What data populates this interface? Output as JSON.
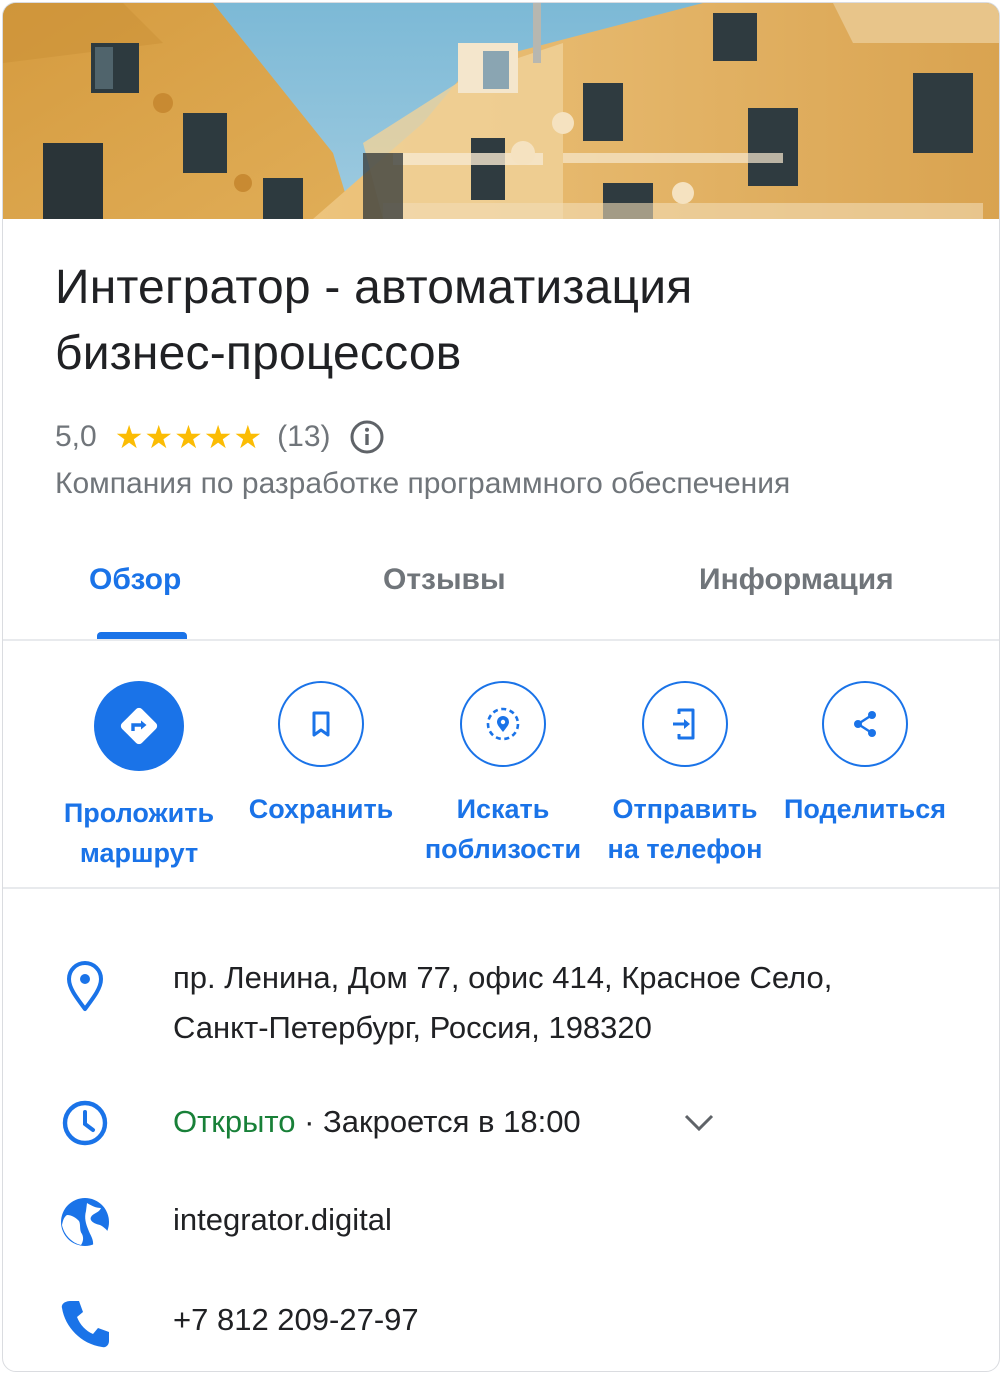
{
  "place": {
    "title_line1": "Интегратор - автоматизация",
    "title_line2": "бизнес-процессов",
    "rating": "5,0",
    "stars": "★★★★★",
    "review_count": "(13)",
    "category": "Компания по разработке программного обеспечения"
  },
  "tabs": [
    {
      "label": "Обзор",
      "active": true
    },
    {
      "label": "Отзывы",
      "active": false
    },
    {
      "label": "Информация",
      "active": false
    }
  ],
  "actions": [
    {
      "label": "Проложить\nмаршрут",
      "icon": "directions-icon"
    },
    {
      "label": "Сохранить",
      "icon": "bookmark-icon"
    },
    {
      "label": "Искать\nпоблизости",
      "icon": "nearby-icon"
    },
    {
      "label": "Отправить\nна телефон",
      "icon": "send-to-phone-icon"
    },
    {
      "label": "Поделиться",
      "icon": "share-icon"
    }
  ],
  "details": {
    "address_line1": "пр. Ленина, Дом 77, офис 414, Красное Село,",
    "address_line2": "Санкт-Петербург, Россия, 198320",
    "hours_status": "Открыто",
    "hours_rest": " · Закроется в 18:00",
    "website": "integrator.digital",
    "phone": "+7 812 209-27-97"
  },
  "colors": {
    "accent": "#1a73e8",
    "open": "#188038",
    "stars": "#fbbc04",
    "secondary_text": "#70757a"
  }
}
